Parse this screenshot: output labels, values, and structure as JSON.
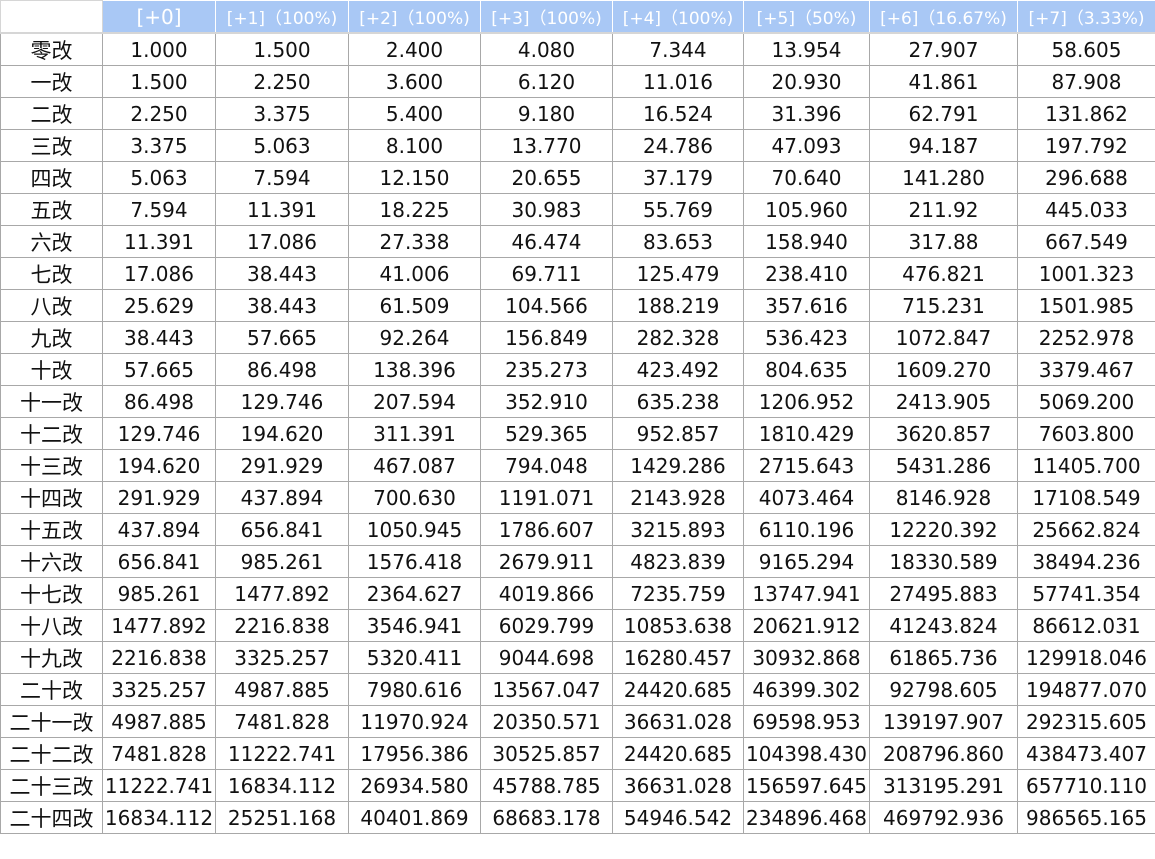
{
  "table": {
    "headers": [
      "[+0]",
      "[+1]（100%)",
      "[+2]（100%)",
      "[+3]（100%)",
      "[+4]（100%)",
      "[+5]（50%)",
      "[+6]（16.67%)",
      "[+7]（3.33%)"
    ],
    "rows": [
      {
        "label": "零改",
        "values": [
          "1.000",
          "1.500",
          "2.400",
          "4.080",
          "7.344",
          "13.954",
          "27.907",
          "58.605"
        ]
      },
      {
        "label": "一改",
        "values": [
          "1.500",
          "2.250",
          "3.600",
          "6.120",
          "11.016",
          "20.930",
          "41.861",
          "87.908"
        ]
      },
      {
        "label": "二改",
        "values": [
          "2.250",
          "3.375",
          "5.400",
          "9.180",
          "16.524",
          "31.396",
          "62.791",
          "131.862"
        ]
      },
      {
        "label": "三改",
        "values": [
          "3.375",
          "5.063",
          "8.100",
          "13.770",
          "24.786",
          "47.093",
          "94.187",
          "197.792"
        ]
      },
      {
        "label": "四改",
        "values": [
          "5.063",
          "7.594",
          "12.150",
          "20.655",
          "37.179",
          "70.640",
          "141.280",
          "296.688"
        ]
      },
      {
        "label": "五改",
        "values": [
          "7.594",
          "11.391",
          "18.225",
          "30.983",
          "55.769",
          "105.960",
          "211.92",
          "445.033"
        ]
      },
      {
        "label": "六改",
        "values": [
          "11.391",
          "17.086",
          "27.338",
          "46.474",
          "83.653",
          "158.940",
          "317.88",
          "667.549"
        ]
      },
      {
        "label": "七改",
        "values": [
          "17.086",
          "38.443",
          "41.006",
          "69.711",
          "125.479",
          "238.410",
          "476.821",
          "1001.323"
        ]
      },
      {
        "label": "八改",
        "values": [
          "25.629",
          "38.443",
          "61.509",
          "104.566",
          "188.219",
          "357.616",
          "715.231",
          "1501.985"
        ]
      },
      {
        "label": "九改",
        "values": [
          "38.443",
          "57.665",
          "92.264",
          "156.849",
          "282.328",
          "536.423",
          "1072.847",
          "2252.978"
        ]
      },
      {
        "label": "十改",
        "values": [
          "57.665",
          "86.498",
          "138.396",
          "235.273",
          "423.492",
          "804.635",
          "1609.270",
          "3379.467"
        ]
      },
      {
        "label": "十一改",
        "values": [
          "86.498",
          "129.746",
          "207.594",
          "352.910",
          "635.238",
          "1206.952",
          "2413.905",
          "5069.200"
        ]
      },
      {
        "label": "十二改",
        "values": [
          "129.746",
          "194.620",
          "311.391",
          "529.365",
          "952.857",
          "1810.429",
          "3620.857",
          "7603.800"
        ]
      },
      {
        "label": "十三改",
        "values": [
          "194.620",
          "291.929",
          "467.087",
          "794.048",
          "1429.286",
          "2715.643",
          "5431.286",
          "11405.700"
        ]
      },
      {
        "label": "十四改",
        "values": [
          "291.929",
          "437.894",
          "700.630",
          "1191.071",
          "2143.928",
          "4073.464",
          "8146.928",
          "17108.549"
        ]
      },
      {
        "label": "十五改",
        "values": [
          "437.894",
          "656.841",
          "1050.945",
          "1786.607",
          "3215.893",
          "6110.196",
          "12220.392",
          "25662.824"
        ]
      },
      {
        "label": "十六改",
        "values": [
          "656.841",
          "985.261",
          "1576.418",
          "2679.911",
          "4823.839",
          "9165.294",
          "18330.589",
          "38494.236"
        ]
      },
      {
        "label": "十七改",
        "values": [
          "985.261",
          "1477.892",
          "2364.627",
          "4019.866",
          "7235.759",
          "13747.941",
          "27495.883",
          "57741.354"
        ]
      },
      {
        "label": "十八改",
        "values": [
          "1477.892",
          "2216.838",
          "3546.941",
          "6029.799",
          "10853.638",
          "20621.912",
          "41243.824",
          "86612.031"
        ]
      },
      {
        "label": "十九改",
        "values": [
          "2216.838",
          "3325.257",
          "5320.411",
          "9044.698",
          "16280.457",
          "30932.868",
          "61865.736",
          "129918.046"
        ]
      },
      {
        "label": "二十改",
        "values": [
          "3325.257",
          "4987.885",
          "7980.616",
          "13567.047",
          "24420.685",
          "46399.302",
          "92798.605",
          "194877.070"
        ]
      },
      {
        "label": "二十一改",
        "values": [
          "4987.885",
          "7481.828",
          "11970.924",
          "20350.571",
          "36631.028",
          "69598.953",
          "139197.907",
          "292315.605"
        ]
      },
      {
        "label": "二十二改",
        "values": [
          "7481.828",
          "11222.741",
          "17956.386",
          "30525.857",
          "24420.685",
          "104398.430",
          "208796.860",
          "438473.407"
        ]
      },
      {
        "label": "二十三改",
        "values": [
          "11222.741",
          "16834.112",
          "26934.580",
          "45788.785",
          "36631.028",
          "156597.645",
          "313195.291",
          "657710.110"
        ]
      },
      {
        "label": "二十四改",
        "values": [
          "16834.112",
          "25251.168",
          "40401.869",
          "68683.178",
          "54946.542",
          "234896.468",
          "469792.936",
          "986565.165"
        ]
      }
    ]
  },
  "colors": {
    "header_bg": "#a9c8f5",
    "header_text": "#ffffff",
    "grid_line": "#a8a8a8",
    "cell_text": "#111111"
  }
}
